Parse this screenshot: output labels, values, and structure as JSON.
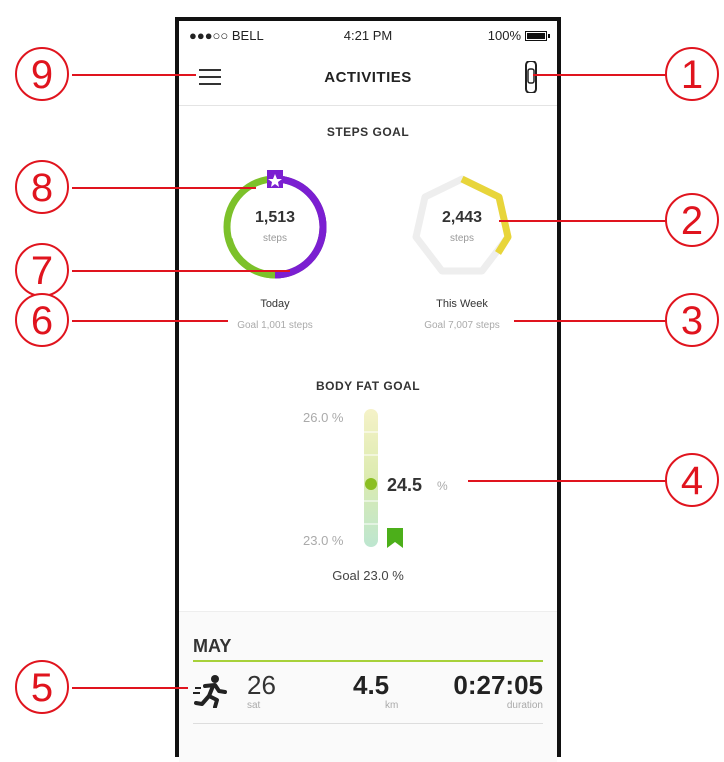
{
  "status_bar": {
    "carrier": "●●●○○ BELL",
    "time": "4:21 PM",
    "battery": "100%"
  },
  "nav": {
    "title": "ACTIVITIES"
  },
  "steps_goal": {
    "title": "STEPS GOAL",
    "today": {
      "value": "1,513",
      "unit": "steps",
      "label": "Today",
      "goal": "Goal 1,001 steps"
    },
    "week": {
      "value": "2,443",
      "unit": "steps",
      "label": "This Week",
      "goal": "Goal 7,007 steps"
    }
  },
  "body_fat": {
    "title": "BODY FAT GOAL",
    "top_label": "26.0 %",
    "bottom_label": "23.0 %",
    "current_value": "24.5",
    "current_unit": "%",
    "goal": "Goal 23.0 %"
  },
  "activity_list": {
    "month": "MAY",
    "rows": [
      {
        "day": "26",
        "weekday": "sat",
        "distance": "4.5",
        "distance_unit": "km",
        "duration": "0:27:05",
        "duration_unit": "duration"
      }
    ]
  },
  "callouts": [
    "1",
    "2",
    "3",
    "4",
    "5",
    "6",
    "7",
    "8",
    "9"
  ],
  "colors": {
    "accent_red": "#e0141e",
    "purple": "#7b1fd1",
    "green": "#7cc12a",
    "yellow": "#e8d53a",
    "bar_green": "#a7d13a"
  }
}
